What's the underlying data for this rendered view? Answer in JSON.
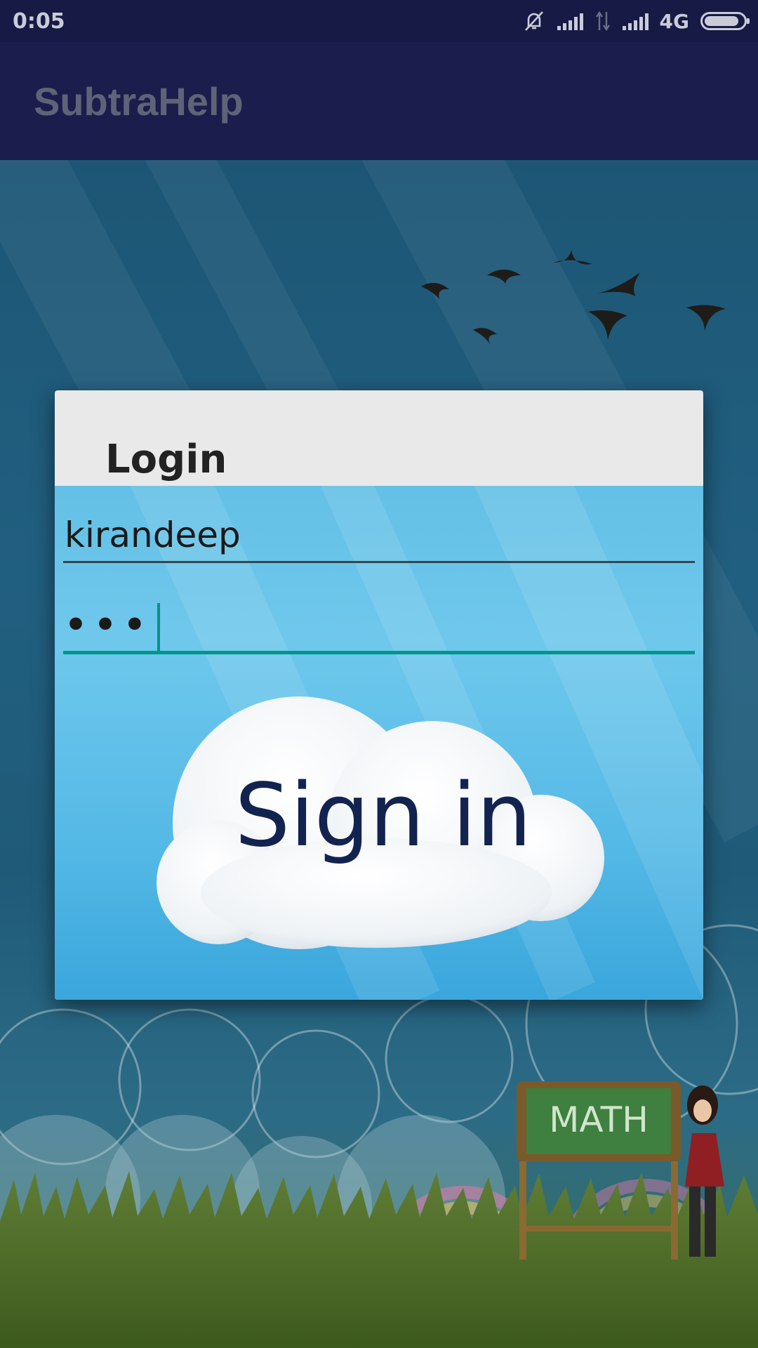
{
  "status_bar": {
    "time": "0:05",
    "network": "4G",
    "icons": [
      "mute-icon",
      "signal-icon",
      "data-arrows-icon",
      "signal-icon",
      "battery-icon"
    ]
  },
  "app_bar": {
    "title": "SubtraHelp"
  },
  "dialog": {
    "title": "Login",
    "username_value": "kirandeep",
    "password_value": "•••",
    "signin_label": "Sign in"
  },
  "illustration": {
    "board_text": "MATH"
  },
  "colors": {
    "status_bar": "#171a45",
    "app_bar": "#1b1e4c",
    "accent": "#009688",
    "dialog_header": "#e9e9e9",
    "signin_text": "#12234f"
  }
}
